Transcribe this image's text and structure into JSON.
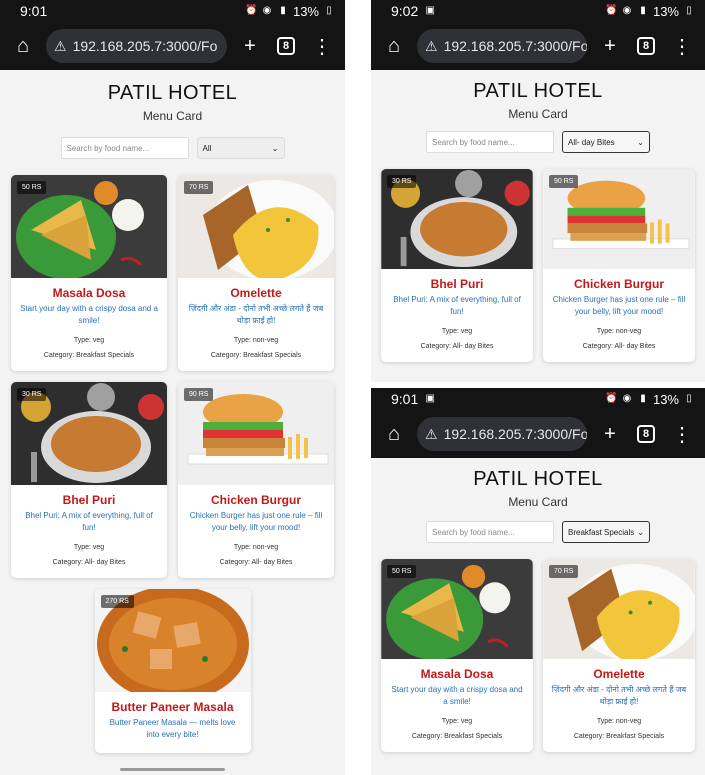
{
  "screens": [
    {
      "time": "9:01",
      "battery": "13%",
      "url": "192.168.205.7:3000/Fo",
      "tab_count": "8",
      "title": "PATIL HOTEL",
      "subtitle": "Menu Card",
      "search_placeholder": "Search by food name...",
      "filter": "All",
      "cards": [
        {
          "name": "Masala Dosa",
          "price": "50 RS",
          "desc": "Start your day with a crispy dosa and a smile!",
          "type": "Type: veg",
          "category": "Category: Breakfast Specials"
        },
        {
          "name": "Omelette",
          "price": "70 RS",
          "desc": "ज़िंदगी और अंडा - दोनो तभी अच्छे लगते हैं जब थोड़ा फ्राई हो!",
          "type": "Type: non-veg",
          "category": "Category: Breakfast Specials"
        },
        {
          "name": "Bhel Puri",
          "price": "30 RS",
          "desc": "Bhel Puri: A mix of everything, full of fun!",
          "type": "Type: veg",
          "category": "Category: All- day Bites"
        },
        {
          "name": "Chicken Burgur",
          "price": "90 RS",
          "desc": "Chicken Burger has just one rule – fill your belly, lift your mood!",
          "type": "Type: non-veg",
          "category": "Category: All- day Bites"
        },
        {
          "name": "Butter Paneer Masala",
          "price": "270 RS",
          "desc": "Butter Paneer Masala — melts love into every bite!",
          "type": "",
          "category": ""
        }
      ]
    },
    {
      "time": "9:02",
      "battery": "13%",
      "url": "192.168.205.7:3000/Fo",
      "tab_count": "8",
      "title": "PATIL HOTEL",
      "subtitle": "Menu Card",
      "search_placeholder": "Search by food name...",
      "filter": "All- day Bites",
      "cards": [
        {
          "name": "Bhel Puri",
          "price": "30 RS",
          "desc": "Bhel Puri: A mix of everything, full of fun!",
          "type": "Type: veg",
          "category": "Category: All- day Bites"
        },
        {
          "name": "Chicken Burgur",
          "price": "90 RS",
          "desc": "Chicken Burger has just one rule – fill your belly, lift your mood!",
          "type": "Type: non-veg",
          "category": "Category: All- day Bites"
        }
      ]
    },
    {
      "time": "9:01",
      "battery": "13%",
      "url": "192.168.205.7:3000/Fo",
      "tab_count": "8",
      "title": "PATIL HOTEL",
      "subtitle": "Menu Card",
      "search_placeholder": "Search by food name...",
      "filter": "Breakfast Specials",
      "cards": [
        {
          "name": "Masala Dosa",
          "price": "50 RS",
          "desc": "Start your day with a crispy dosa and a smile!",
          "type": "Type: veg",
          "category": "Category: Breakfast Specials"
        },
        {
          "name": "Omelette",
          "price": "70 RS",
          "desc": "ज़िंदगी और अंडा - दोनो तभी अच्छे लगते हैं जब थोड़ा फ्राई हो!",
          "type": "Type: non-veg",
          "category": "Category: Breakfast Specials"
        }
      ]
    }
  ],
  "colors": {
    "accent_name": "#c41818",
    "accent_desc": "#2870b8",
    "chrome": "#141414"
  }
}
